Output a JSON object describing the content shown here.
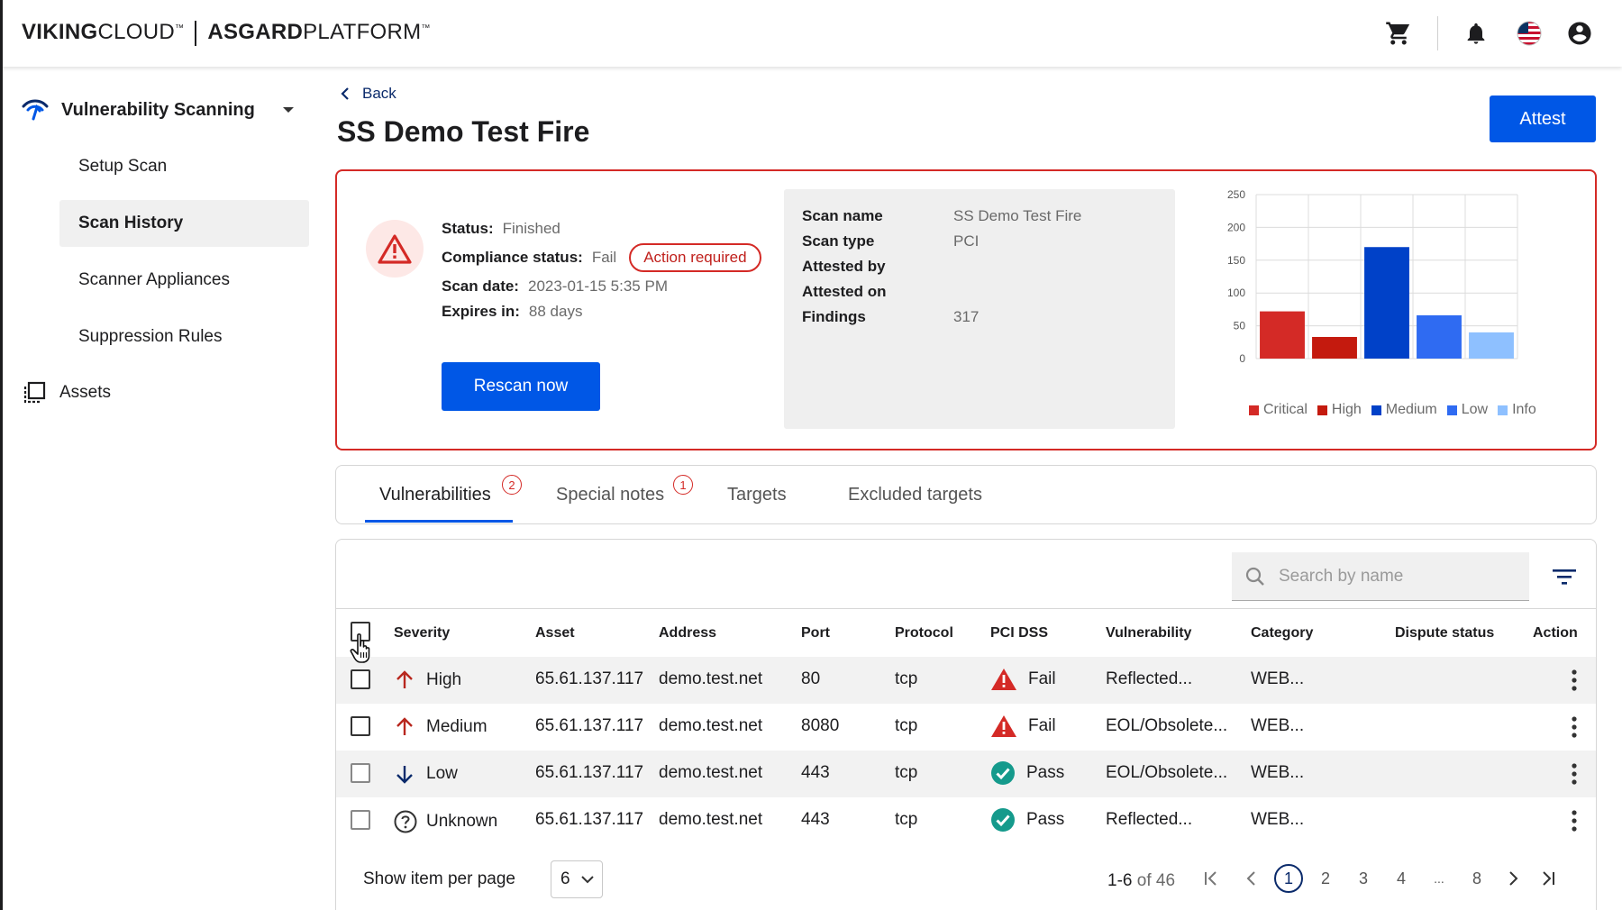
{
  "header": {
    "brand_primary": "VIKING",
    "brand_secondary": "CLOUD",
    "platform_primary": "ASGARD",
    "platform_secondary": "PLATFORM",
    "tm": "™",
    "icons": [
      "cart-icon",
      "bell-icon",
      "us-flag-icon",
      "account-icon"
    ]
  },
  "sidebar": {
    "section": "Vulnerability Scanning",
    "items": [
      {
        "label": "Setup Scan",
        "active": false
      },
      {
        "label": "Scan History",
        "active": true
      },
      {
        "label": "Scanner Appliances",
        "active": false
      },
      {
        "label": "Suppression Rules",
        "active": false
      }
    ],
    "assets": "Assets"
  },
  "page": {
    "back": "Back",
    "title": "SS Demo Test Fire",
    "attest": "Attest"
  },
  "summary": {
    "status_label": "Status:",
    "status_value": "Finished",
    "compliance_label": "Compliance status:",
    "compliance_value": "Fail",
    "compliance_badge": "Action required",
    "scan_date_label": "Scan date:",
    "scan_date_value": "2023-01-15 5:35 PM",
    "expires_label": "Expires in:",
    "expires_value": "88 days",
    "rescan": "Rescan now",
    "details": [
      {
        "key": "Scan name",
        "value": "SS Demo Test Fire"
      },
      {
        "key": "Scan type",
        "value": "PCI"
      },
      {
        "key": "Attested by",
        "value": ""
      },
      {
        "key": "Attested on",
        "value": ""
      },
      {
        "key": "Findings",
        "value": "317"
      }
    ]
  },
  "chart_data": {
    "type": "bar",
    "categories": [
      "Critical",
      "High",
      "Medium",
      "Low",
      "Info"
    ],
    "values": [
      72,
      33,
      170,
      66,
      40
    ],
    "colors": [
      "#d42a26",
      "#c41a0e",
      "#0041c8",
      "#2f6bf2",
      "#8ec0ff"
    ],
    "ylim": [
      0,
      250
    ],
    "yticks": [
      0,
      50,
      100,
      150,
      200,
      250
    ],
    "grid": true,
    "legend": "bottom"
  },
  "tabs": [
    {
      "label": "Vulnerabilities",
      "badge": "2",
      "active": true
    },
    {
      "label": "Special notes",
      "badge": "1",
      "active": false
    },
    {
      "label": "Targets",
      "badge": "",
      "active": false
    },
    {
      "label": "Excluded targets",
      "badge": "",
      "active": false
    }
  ],
  "table": {
    "search_placeholder": "Search by name",
    "columns": [
      "Severity",
      "Asset",
      "Address",
      "Port",
      "Protocol",
      "PCI DSS",
      "Vulnerability",
      "Category",
      "Dispute status",
      "Action"
    ],
    "rows": [
      {
        "severity": "High",
        "severity_icon": "arrow-up-icon",
        "asset": "65.61.137.117",
        "address": "demo.test.net",
        "port": "80",
        "protocol": "tcp",
        "pci": "Fail",
        "vulnerability": "Reflected...",
        "category": "WEB...",
        "dispute": ""
      },
      {
        "severity": "Medium",
        "severity_icon": "arrow-up-icon",
        "asset": "65.61.137.117",
        "address": "demo.test.net",
        "port": "8080",
        "protocol": "tcp",
        "pci": "Fail",
        "vulnerability": "EOL/Obsolete...",
        "category": "WEB...",
        "dispute": ""
      },
      {
        "severity": "Low",
        "severity_icon": "arrow-down-icon",
        "asset": "65.61.137.117",
        "address": "demo.test.net",
        "port": "443",
        "protocol": "tcp",
        "pci": "Pass",
        "vulnerability": "EOL/Obsolete...",
        "category": "WEB...",
        "dispute": ""
      },
      {
        "severity": "Unknown",
        "severity_icon": "question-icon",
        "asset": "65.61.137.117",
        "address": "demo.test.net",
        "port": "443",
        "protocol": "tcp",
        "pci": "Pass",
        "vulnerability": "Reflected...",
        "category": "WEB...",
        "dispute": ""
      }
    ],
    "per_page_label": "Show item per page",
    "per_page_value": "6",
    "range_start": "1-6",
    "range_rest": "of 46",
    "pages": [
      "1",
      "2",
      "3",
      "4",
      "...",
      "8"
    ]
  }
}
